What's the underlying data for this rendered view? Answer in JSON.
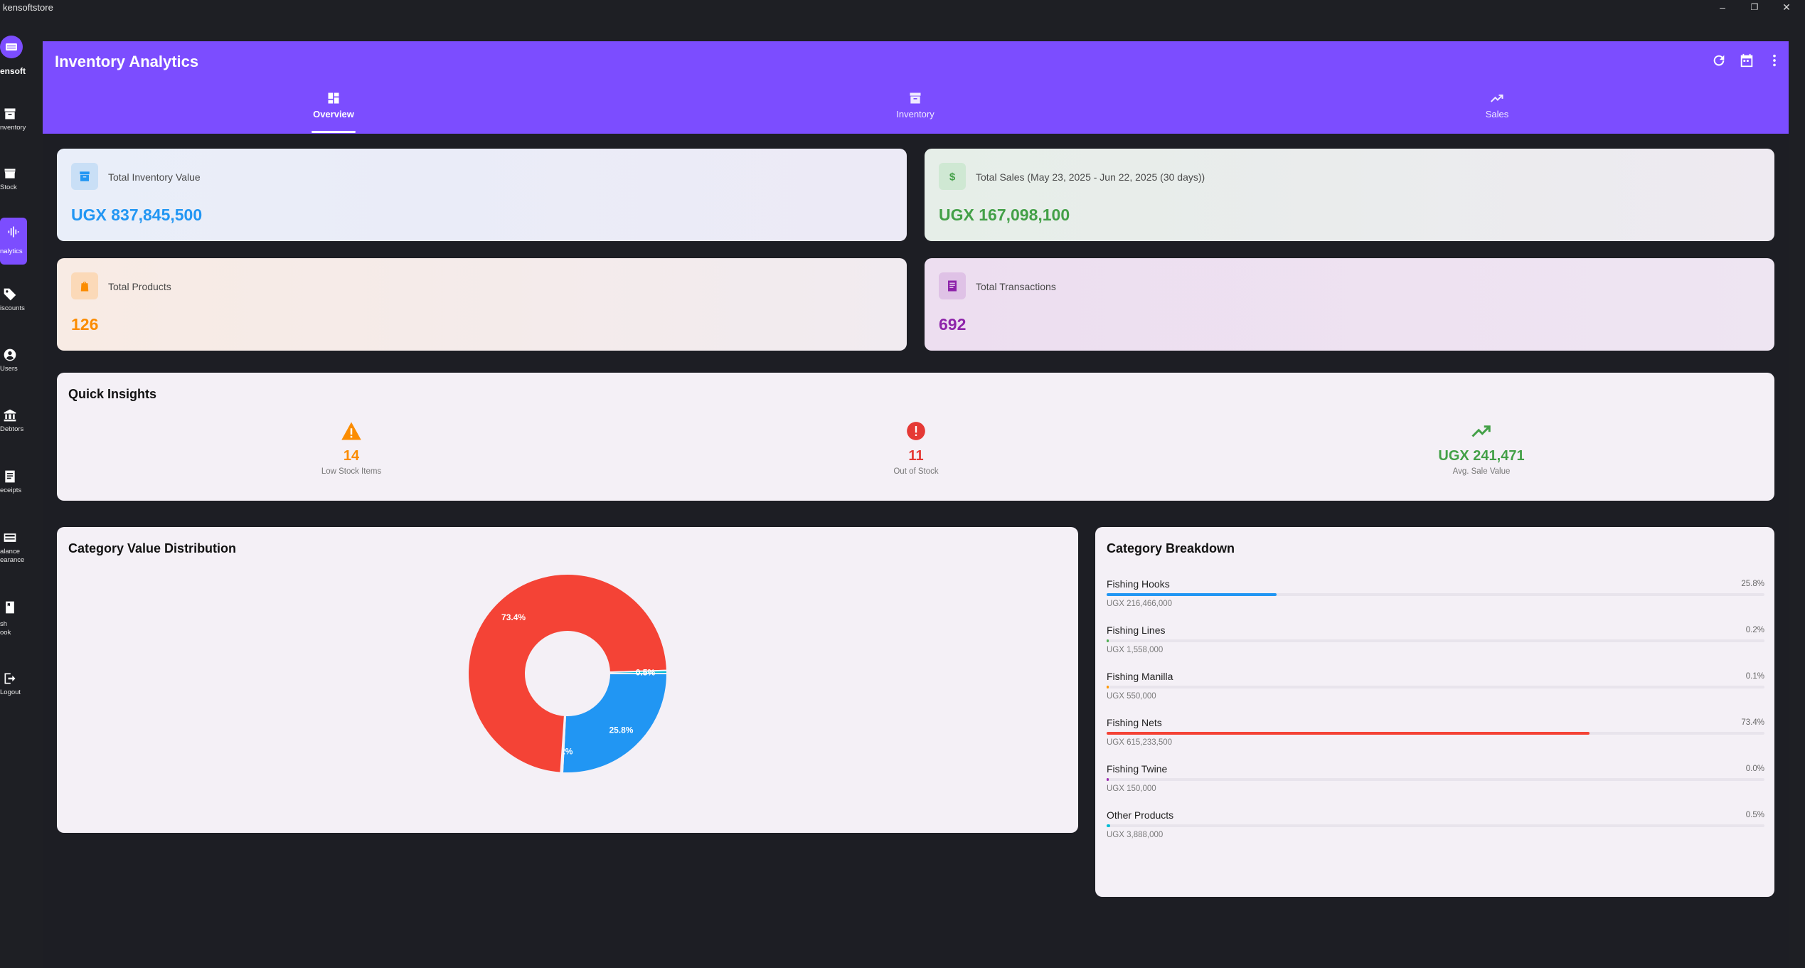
{
  "window": {
    "title": "kensoftstore"
  },
  "sidebar": {
    "brand": "ensoft",
    "items": [
      {
        "label": "nventory",
        "icon": "archive-icon"
      },
      {
        "label": "Stock",
        "icon": "store-icon"
      },
      {
        "label": "nalytics",
        "icon": "analytics-icon",
        "active": true
      },
      {
        "label": "iscounts",
        "icon": "tag-icon"
      },
      {
        "label": "Users",
        "icon": "user-icon"
      },
      {
        "label": "Debtors",
        "icon": "bank-icon"
      },
      {
        "label": "eceipts",
        "icon": "receipt-icon"
      },
      {
        "label": "alance\nearance",
        "icon": "balance-icon"
      },
      {
        "label": "sh\nook",
        "icon": "book-icon"
      },
      {
        "label": "Logout",
        "icon": "logout-icon"
      }
    ]
  },
  "appbar": {
    "title": "Inventory Analytics",
    "tabs": [
      {
        "label": "Overview",
        "icon": "dashboard-icon",
        "active": true
      },
      {
        "label": "Inventory",
        "icon": "archive-icon"
      },
      {
        "label": "Sales",
        "icon": "trending-up-icon"
      }
    ]
  },
  "stats": {
    "inventory_value": {
      "label": "Total Inventory Value",
      "value": "UGX 837,845,500",
      "color": "#2196f3"
    },
    "sales": {
      "label": "Total Sales (May 23, 2025 - Jun 22, 2025 (30 days))",
      "value": "UGX 167,098,100",
      "color": "#43a047"
    },
    "products": {
      "label": "Total Products",
      "value": "126",
      "color": "#fb8c00"
    },
    "transactions": {
      "label": "Total Transactions",
      "value": "692",
      "color": "#8e24aa"
    }
  },
  "insights": {
    "title": "Quick Insights",
    "low_stock": {
      "value": "14",
      "label": "Low Stock Items"
    },
    "out_of_stock": {
      "value": "11",
      "label": "Out of Stock"
    },
    "avg_sale": {
      "value": "UGX 241,471",
      "label": "Avg. Sale Value"
    }
  },
  "distribution": {
    "title": "Category Value Distribution"
  },
  "breakdown": {
    "title": "Category Breakdown",
    "items": [
      {
        "name": "Fishing Hooks",
        "percent": "25.8%",
        "value": "UGX 216,466,000",
        "fraction": 0.258,
        "color": "#2196f3"
      },
      {
        "name": "Fishing Lines",
        "percent": "0.2%",
        "value": "UGX 1,558,000",
        "fraction": 0.002,
        "color": "#4caf50"
      },
      {
        "name": "Fishing Manilla",
        "percent": "0.1%",
        "value": "UGX 550,000",
        "fraction": 0.001,
        "color": "#ff9800"
      },
      {
        "name": "Fishing Nets",
        "percent": "73.4%",
        "value": "UGX 615,233,500",
        "fraction": 0.734,
        "color": "#f44336"
      },
      {
        "name": "Fishing Twine",
        "percent": "0.0%",
        "value": "UGX 150,000",
        "fraction": 0.0,
        "color": "#9c27b0"
      },
      {
        "name": "Other Products",
        "percent": "0.5%",
        "value": "UGX 3,888,000",
        "fraction": 0.005,
        "color": "#00bcd4"
      }
    ]
  },
  "chart_data": {
    "type": "pie",
    "donut": true,
    "labels": [
      "Fishing Hooks",
      "Fishing Lines",
      "Fishing Manilla",
      "Fishing Nets",
      "Fishing Twine",
      "Other Products"
    ],
    "values": [
      25.8,
      0.2,
      0.1,
      73.4,
      0.0,
      0.5
    ],
    "slice_labels": [
      "25.8%",
      "0.2%",
      "",
      "73.4%",
      "",
      "0.5%"
    ],
    "colors": [
      "#2196f3",
      "#4caf50",
      "#ff9800",
      "#f44336",
      "#9c27b0",
      "#00bcd4"
    ]
  }
}
